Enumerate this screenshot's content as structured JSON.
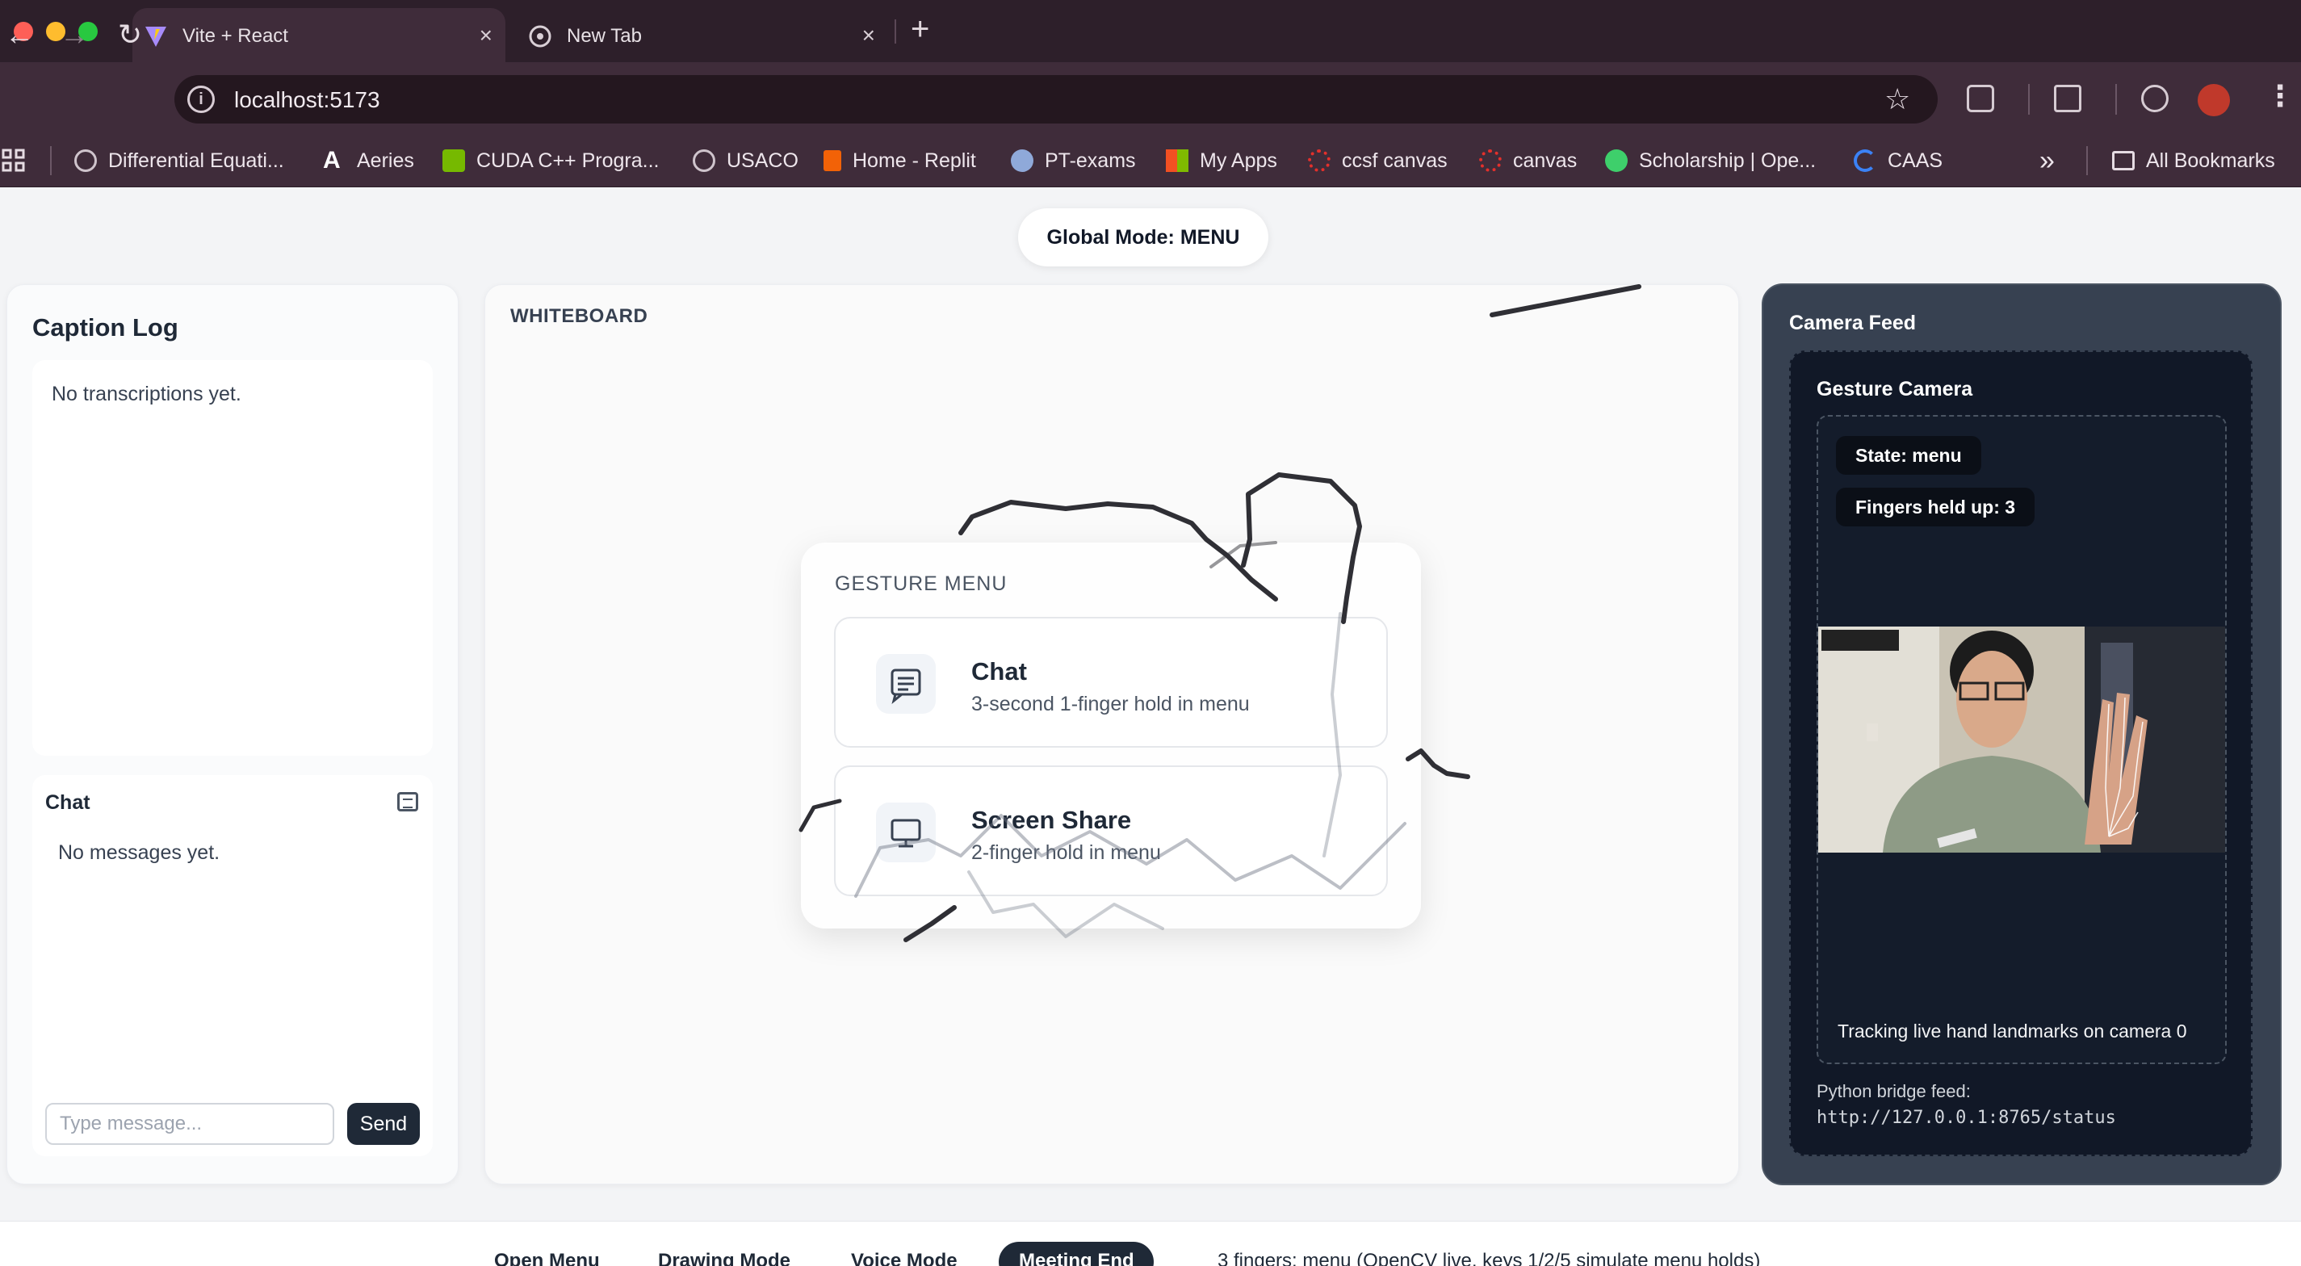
{
  "browser": {
    "tabs": [
      {
        "title": "Vite + React",
        "active": true
      },
      {
        "title": "New Tab",
        "active": false
      }
    ],
    "url": "localhost:5173",
    "bookmarks": [
      {
        "label": "Differential Equati...",
        "icon": "globe-icon"
      },
      {
        "label": "Aeries",
        "icon": "aeries-icon"
      },
      {
        "label": "CUDA C++ Progra...",
        "icon": "nvidia-icon"
      },
      {
        "label": "USACO",
        "icon": "globe-icon"
      },
      {
        "label": "Home - Replit",
        "icon": "replit-icon"
      },
      {
        "label": "PT-exams",
        "icon": "pt-icon"
      },
      {
        "label": "My Apps",
        "icon": "microsoft-icon"
      },
      {
        "label": "ccsf canvas",
        "icon": "canvas-icon"
      },
      {
        "label": "canvas",
        "icon": "canvas-icon"
      },
      {
        "label": "Scholarship | Ope...",
        "icon": "scholarship-icon"
      },
      {
        "label": "CAAS",
        "icon": "caas-icon"
      }
    ],
    "overflow_label": "»",
    "all_bookmarks": "All Bookmarks"
  },
  "app": {
    "global_mode": "Global Mode: MENU",
    "caption_log": {
      "title": "Caption Log",
      "empty": "No transcriptions yet."
    },
    "chat": {
      "title": "Chat",
      "empty": "No messages yet.",
      "input_placeholder": "Type message...",
      "send": "Send"
    },
    "whiteboard": {
      "label": "WHITEBOARD"
    },
    "gesture_menu": {
      "title": "GESTURE MENU",
      "items": [
        {
          "name": "Chat",
          "desc": "3-second 1-finger hold in menu",
          "icon": "chat-icon"
        },
        {
          "name": "Screen Share",
          "desc": "2-finger hold in menu",
          "icon": "monitor-icon"
        }
      ]
    },
    "camera": {
      "title": "Camera Feed",
      "inner_title": "Gesture Camera",
      "state": "State: menu",
      "fingers": "Fingers held up: 3",
      "status": "Tracking live hand landmarks on camera 0",
      "bridge_label": "Python bridge feed:",
      "bridge_url": "http://127.0.0.1:8765/status"
    },
    "bottom_bar": {
      "items": [
        "Open Menu",
        "Drawing Mode",
        "Voice Mode",
        "Meeting End"
      ],
      "hint": "3 fingers: menu (OpenCV live, keys 1/2/5 simulate menu holds)"
    }
  },
  "colors": {
    "chrome_dark": "#2d1f2a",
    "chrome": "#3f2c3a",
    "camera_panel": "#374151",
    "primary_button": "#1f2937"
  }
}
